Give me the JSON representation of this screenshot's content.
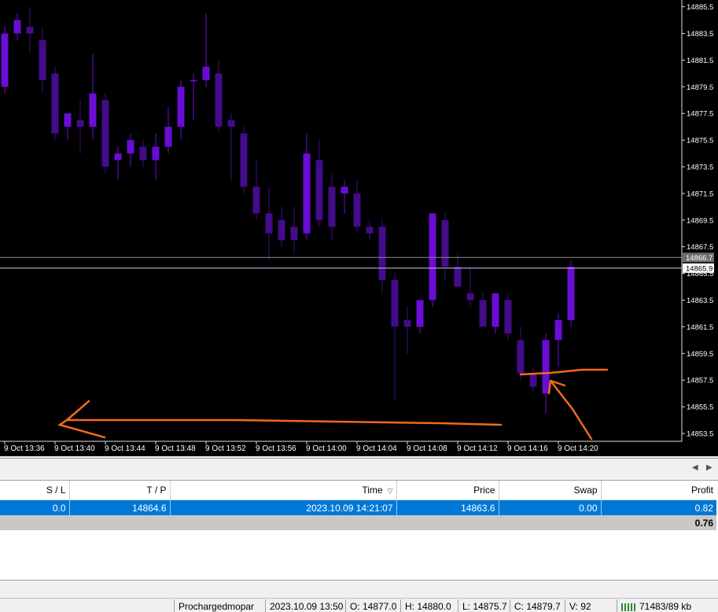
{
  "chart": {
    "background": "#000000",
    "bull_color": "#6a0dd6",
    "bear_color": "#420c8a",
    "price_lines": [
      {
        "price": 14866.7,
        "label": "14866.7",
        "style": "grey"
      },
      {
        "price": 14865.9,
        "label": "14865.9",
        "style": "white"
      }
    ],
    "price_ticks": [
      "14885.5",
      "14883.5",
      "14881.5",
      "14879.5",
      "14877.5",
      "14875.5",
      "14873.5",
      "14871.5",
      "14869.5",
      "14867.5",
      "14865.5",
      "14863.5",
      "14861.5",
      "14859.5",
      "14857.5",
      "14855.5",
      "14853.5"
    ],
    "time_labels": [
      "9 Oct 13:36",
      "9 Oct 13:40",
      "9 Oct 13:44",
      "9 Oct 13:48",
      "9 Oct 13:52",
      "9 Oct 13:56",
      "9 Oct 14:00",
      "9 Oct 14:04",
      "9 Oct 14:08",
      "9 Oct 14:12",
      "9 Oct 14:16",
      "9 Oct 14:20"
    ],
    "annotation_color": "#f06a1e"
  },
  "chart_data": {
    "type": "candlestick",
    "y_range": [
      14852.5,
      14886.5
    ],
    "candles": [
      {
        "o": 14879.5,
        "h": 14884.0,
        "l": 14879.0,
        "c": 14883.5
      },
      {
        "o": 14883.5,
        "h": 14885.0,
        "l": 14883.0,
        "c": 14884.5
      },
      {
        "o": 14884.0,
        "h": 14885.5,
        "l": 14882.0,
        "c": 14883.5
      },
      {
        "o": 14883.0,
        "h": 14884.0,
        "l": 14879.0,
        "c": 14880.0
      },
      {
        "o": 14880.5,
        "h": 14881.0,
        "l": 14875.5,
        "c": 14876.0
      },
      {
        "o": 14876.5,
        "h": 14877.5,
        "l": 14875.5,
        "c": 14877.5
      },
      {
        "o": 14877.0,
        "h": 14878.5,
        "l": 14874.5,
        "c": 14876.5
      },
      {
        "o": 14876.5,
        "h": 14882.0,
        "l": 14875.5,
        "c": 14879.0
      },
      {
        "o": 14878.5,
        "h": 14879.0,
        "l": 14873.0,
        "c": 14873.5
      },
      {
        "o": 14874.0,
        "h": 14875.0,
        "l": 14872.5,
        "c": 14874.5
      },
      {
        "o": 14874.5,
        "h": 14876.0,
        "l": 14873.5,
        "c": 14875.5
      },
      {
        "o": 14875.0,
        "h": 14875.5,
        "l": 14873.5,
        "c": 14874.0
      },
      {
        "o": 14874.0,
        "h": 14876.0,
        "l": 14872.5,
        "c": 14875.0
      },
      {
        "o": 14875.0,
        "h": 14878.0,
        "l": 14874.5,
        "c": 14876.5
      },
      {
        "o": 14876.5,
        "h": 14880.0,
        "l": 14875.5,
        "c": 14879.5
      },
      {
        "o": 14880.0,
        "h": 14880.5,
        "l": 14877.0,
        "c": 14880.0
      },
      {
        "o": 14880.0,
        "h": 14885.0,
        "l": 14879.5,
        "c": 14881.0
      },
      {
        "o": 14880.5,
        "h": 14881.5,
        "l": 14876.0,
        "c": 14876.5
      },
      {
        "o": 14877.0,
        "h": 14877.5,
        "l": 14872.5,
        "c": 14876.5
      },
      {
        "o": 14876.0,
        "h": 14876.5,
        "l": 14871.5,
        "c": 14872.0
      },
      {
        "o": 14872.0,
        "h": 14874.0,
        "l": 14869.5,
        "c": 14870.0
      },
      {
        "o": 14870.0,
        "h": 14872.0,
        "l": 14866.5,
        "c": 14868.5
      },
      {
        "o": 14869.5,
        "h": 14870.5,
        "l": 14867.5,
        "c": 14868.0
      },
      {
        "o": 14869.0,
        "h": 14870.5,
        "l": 14867.0,
        "c": 14868.0
      },
      {
        "o": 14868.5,
        "h": 14876.0,
        "l": 14868.0,
        "c": 14874.5
      },
      {
        "o": 14874.0,
        "h": 14875.5,
        "l": 14869.0,
        "c": 14869.5
      },
      {
        "o": 14872.0,
        "h": 14873.0,
        "l": 14868.0,
        "c": 14869.0
      },
      {
        "o": 14871.5,
        "h": 14872.5,
        "l": 14870.0,
        "c": 14872.0
      },
      {
        "o": 14871.5,
        "h": 14872.5,
        "l": 14868.5,
        "c": 14869.0
      },
      {
        "o": 14869.0,
        "h": 14869.5,
        "l": 14868.0,
        "c": 14868.5
      },
      {
        "o": 14869.0,
        "h": 14869.5,
        "l": 14864.0,
        "c": 14865.0
      },
      {
        "o": 14865.0,
        "h": 14865.5,
        "l": 14856.0,
        "c": 14861.5
      },
      {
        "o": 14862.0,
        "h": 14863.0,
        "l": 14859.5,
        "c": 14861.5
      },
      {
        "o": 14861.5,
        "h": 14863.5,
        "l": 14861.0,
        "c": 14863.5
      },
      {
        "o": 14863.5,
        "h": 14870.0,
        "l": 14863.0,
        "c": 14870.0
      },
      {
        "o": 14869.5,
        "h": 14870.0,
        "l": 14865.0,
        "c": 14866.0
      },
      {
        "o": 14866.0,
        "h": 14867.0,
        "l": 14864.5,
        "c": 14864.5
      },
      {
        "o": 14864.0,
        "h": 14866.0,
        "l": 14863.0,
        "c": 14863.5
      },
      {
        "o": 14863.5,
        "h": 14864.0,
        "l": 14861.5,
        "c": 14861.5
      },
      {
        "o": 14861.5,
        "h": 14864.0,
        "l": 14861.0,
        "c": 14864.0
      },
      {
        "o": 14863.5,
        "h": 14864.0,
        "l": 14860.5,
        "c": 14861.0
      },
      {
        "o": 14860.5,
        "h": 14861.5,
        "l": 14857.5,
        "c": 14858.0
      },
      {
        "o": 14858.0,
        "h": 14858.5,
        "l": 14856.5,
        "c": 14857.0
      },
      {
        "o": 14856.5,
        "h": 14861.0,
        "l": 14855.0,
        "c": 14860.5
      },
      {
        "o": 14860.5,
        "h": 14862.5,
        "l": 14858.5,
        "c": 14862.0
      },
      {
        "o": 14862.0,
        "h": 14866.5,
        "l": 14861.5,
        "c": 14866.0
      }
    ]
  },
  "trades": {
    "columns": [
      {
        "key": "sl",
        "label": "S / L"
      },
      {
        "key": "tp",
        "label": "T / P"
      },
      {
        "key": "time",
        "label": "Time"
      },
      {
        "key": "price",
        "label": "Price"
      },
      {
        "key": "swap",
        "label": "Swap"
      },
      {
        "key": "profit",
        "label": "Profit"
      }
    ],
    "row": {
      "sl": "0.0",
      "tp": "14864.6",
      "time": "2023.10.09 14:21:07",
      "price": "14863.6",
      "swap": "0.00",
      "profit": "0.82"
    },
    "total": "0.76",
    "selected_color": "#0078d7"
  },
  "status_bar": {
    "profile": "Prochargedmopar",
    "datetime": "2023.10.09 13:50",
    "open": "O: 14877.0",
    "high": "H: 14880.0",
    "low": "L: 14875.7",
    "close": "C: 14879.7",
    "volume": "V: 92",
    "traffic": "71483/89 kb"
  }
}
